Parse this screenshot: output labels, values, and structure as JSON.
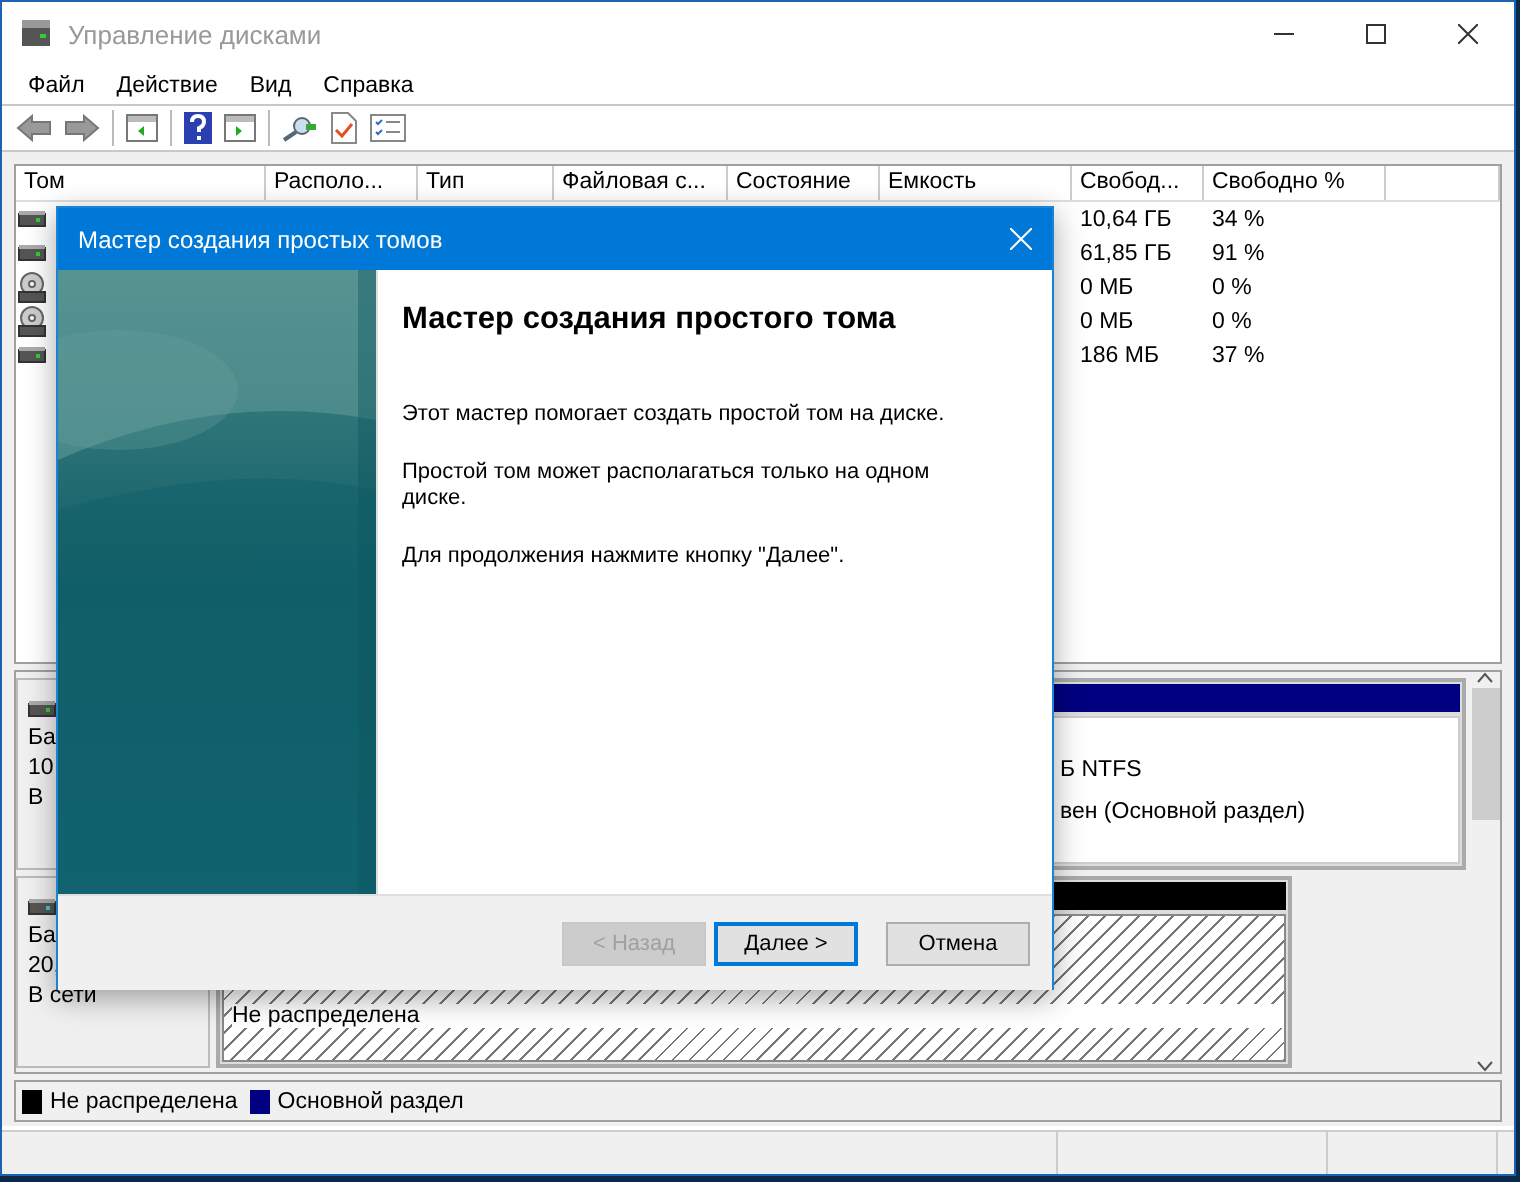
{
  "window": {
    "title": "Управление дисками"
  },
  "menu": [
    "Файл",
    "Действие",
    "Вид",
    "Справка"
  ],
  "volume_table": {
    "columns": [
      "Том",
      "Располо...",
      "Тип",
      "Файловая с...",
      "Состояние",
      "Емкость",
      "Свобод...",
      "Свободно %"
    ],
    "rows": [
      {
        "kind": "drive",
        "free": "10,64 ГБ",
        "free_percent": "34 %"
      },
      {
        "kind": "drive",
        "free": "61,85 ГБ",
        "free_percent": "91 %"
      },
      {
        "kind": "optical",
        "free": "0 МБ",
        "free_percent": "0 %"
      },
      {
        "kind": "optical",
        "free": "0 МБ",
        "free_percent": "0 %"
      },
      {
        "kind": "drive",
        "free": "186 МБ",
        "free_percent": "37 %"
      }
    ]
  },
  "disks": [
    {
      "label": [
        "Ба",
        "10",
        "В"
      ],
      "partitions": [
        {
          "kind": "primary",
          "lines": [
            "Б NTFS",
            "вен (Основной раздел)"
          ]
        }
      ]
    },
    {
      "label": [
        "Ба",
        "20,",
        "В сети"
      ],
      "partitions": [
        {
          "kind": "unallocated",
          "lines": [
            "Не распределена"
          ]
        }
      ]
    }
  ],
  "legend": [
    {
      "label": "Не распределена",
      "color": "#000000"
    },
    {
      "label": "Основной раздел",
      "color": "#000080"
    }
  ],
  "dialog": {
    "title": "Мастер создания простых томов",
    "heading": "Мастер создания простого тома",
    "paragraphs": [
      "Этот мастер помогает создать простой том на диске.",
      "Простой том может располагаться только на одном диске.",
      "Для продолжения нажмите кнопку \"Далее\"."
    ],
    "buttons": [
      {
        "label": "< Назад",
        "disabled": true,
        "default": false
      },
      {
        "label": "Далее >",
        "disabled": false,
        "default": true
      },
      {
        "label": "Отмена",
        "disabled": false,
        "default": false
      }
    ]
  }
}
